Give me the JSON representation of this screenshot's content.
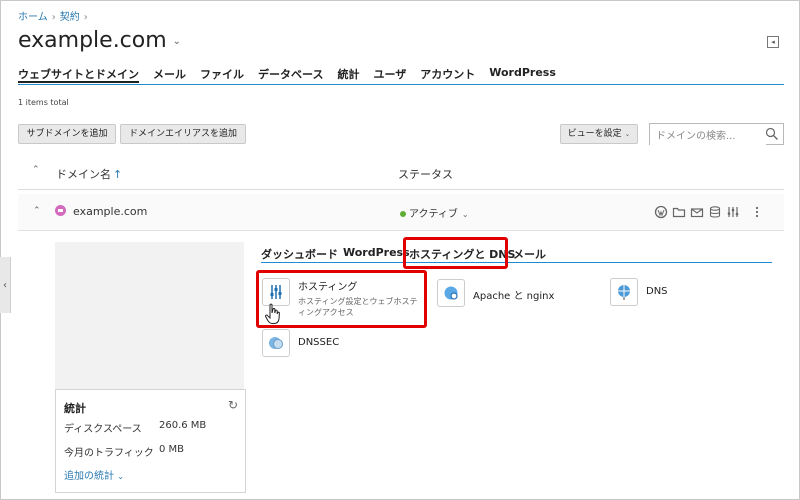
{
  "breadcrumb": {
    "home": "ホーム",
    "contract": "契約"
  },
  "page": {
    "title": "example.com"
  },
  "tabs": [
    "ウェブサイトとドメイン",
    "メール",
    "ファイル",
    "データベース",
    "統計",
    "ユーザ",
    "アカウント",
    "WordPress"
  ],
  "list": {
    "total": "1 items total",
    "add_subdomain": "サブドメインを追加",
    "add_alias": "ドメインエイリアスを追加",
    "view_settings": "ビューを設定",
    "search_placeholder": "ドメインの検索..."
  },
  "table": {
    "col_domain": "ドメイン名",
    "sort_arrow": "↑",
    "col_status": "ステータス"
  },
  "domain": {
    "name": "example.com",
    "status": "アクティブ",
    "status_color": "#5fae32"
  },
  "stats": {
    "title": "統計",
    "disk_label": "ディスクスペース",
    "disk_value": "260.6 MB",
    "traffic_label": "今月のトラフィック",
    "traffic_value": "0 MB",
    "more": "追加の統計"
  },
  "subtabs": [
    "ダッシュボード",
    "WordPress",
    "ホスティングと DNS",
    "メール"
  ],
  "tiles": {
    "hosting_title": "ホスティング",
    "hosting_desc": "ホスティング設定とウェブホスティングアクセス",
    "apache_title": "Apache と nginx",
    "dns_title": "DNS",
    "dnssec_title": "DNSSEC"
  },
  "colors": {
    "accent": "#1f8ccf",
    "highlight": "#e00000",
    "link": "#2a7ab0"
  }
}
